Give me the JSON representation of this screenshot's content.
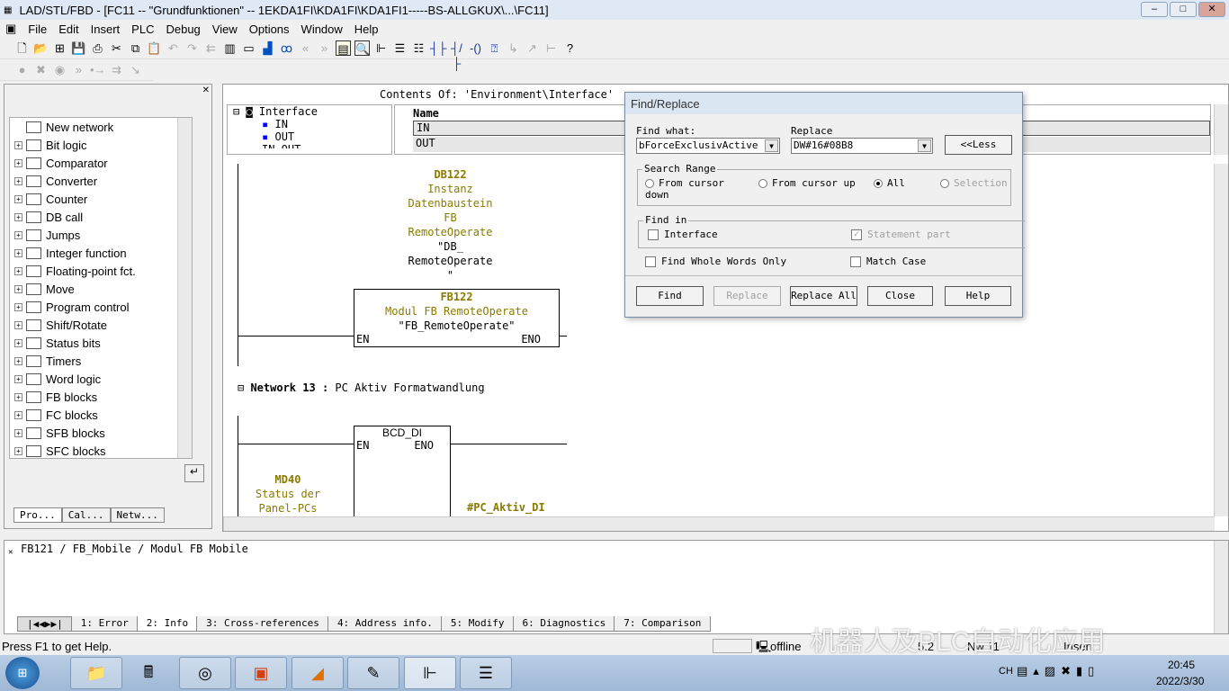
{
  "window": {
    "title": "LAD/STL/FBD  - [FC11 -- \"Grundfunktionen\" -- 1EKDA1FI\\KDA1FI\\KDA1FI1-----BS-ALLGKUX\\...\\FC11]",
    "min": "–",
    "max": "□",
    "close": "✕"
  },
  "menu": [
    "File",
    "Edit",
    "Insert",
    "PLC",
    "Debug",
    "View",
    "Options",
    "Window",
    "Help"
  ],
  "toolbar1": [
    "new-icon",
    "open-icon",
    "accessible-nodes-icon",
    "save-icon",
    "print-icon",
    "cut-icon",
    "copy-icon",
    "paste-icon",
    "undo-icon",
    "redo-icon",
    "load-icon",
    "download-icon",
    "overview-icon",
    "monitor-icon",
    "glasses-icon",
    "prev-icon",
    "next-icon",
    "catalog-icon",
    "preview-icon",
    "branch-icon",
    "contact-icon",
    "nc-contact-icon",
    "coil-icon",
    "box-icon",
    "help-icon"
  ],
  "sidebar": {
    "items": [
      "New network",
      "Bit logic",
      "Comparator",
      "Converter",
      "Counter",
      "DB call",
      "Jumps",
      "Integer function",
      "Floating-point fct.",
      "Move",
      "Program control",
      "Shift/Rotate",
      "Status bits",
      "Timers",
      "Word logic",
      "FB blocks",
      "FC blocks",
      "SFB blocks",
      "SFC blocks"
    ],
    "tabs": [
      "Pro...",
      "Cal...",
      "Netw..."
    ]
  },
  "interface": {
    "header": "Contents Of: 'Environment\\Interface'",
    "tree": [
      "Interface",
      "IN",
      "OUT",
      "IN_OUT"
    ],
    "column": "Name",
    "rows": [
      "IN",
      "OUT"
    ]
  },
  "network12": {
    "db": "DB122",
    "db_comment": [
      "Instanz",
      "Datenbaustein",
      "FB",
      "RemoteOperate"
    ],
    "db_symbol": [
      "\"DB_",
      "RemoteOperate",
      "\""
    ],
    "fb": "FB122",
    "fb_comment": "Modul FB RemoteOperate",
    "fb_symbol": "\"FB_RemoteOperate\"",
    "en": "EN",
    "eno": "ENO"
  },
  "network13": {
    "label": "Network 13",
    "sep": ":",
    "title": "PC Aktiv Formatwandlung",
    "box": "BCD_DI",
    "en": "EN",
    "eno": "ENO",
    "in_addr": "MD40",
    "in_comment": [
      "Status der",
      "Panel-PCs"
    ],
    "out": "#PC_Aktiv_DI"
  },
  "dialog": {
    "title": "Find/Replace",
    "find_label": "Find what:",
    "find_value": "bForceExclusivActive",
    "replace_label": "Replace",
    "replace_value": "DW#16#08B8",
    "less": "<<Less",
    "search_range": "Search Range",
    "ranges": [
      "From cursor down",
      "From cursor up",
      "All",
      "Selection"
    ],
    "selected_range": "All",
    "find_in": "Find in",
    "interface": "Interface",
    "statement": "Statement part",
    "whole": "Find Whole Words Only",
    "match": "Match Case",
    "buttons": [
      "Find",
      "Replace",
      "Replace All",
      "Close",
      "Help"
    ]
  },
  "info": {
    "text": "FB121 / FB_Mobile / Modul FB Mobile",
    "tabs": [
      "1: Error",
      "2: Info",
      "3: Cross-references",
      "4: Address info.",
      "5: Modify",
      "6: Diagnostics",
      "7: Comparison"
    ]
  },
  "status": {
    "help": "Press F1 to get Help.",
    "mode": "offline",
    "pos": "5.2",
    "nw": "Nw 11",
    "ins": "Insert"
  },
  "watermark": "机器人及PLC自动化应用",
  "taskbar": {
    "lang": "CH",
    "time": "20:45",
    "date": "2022/3/30"
  }
}
